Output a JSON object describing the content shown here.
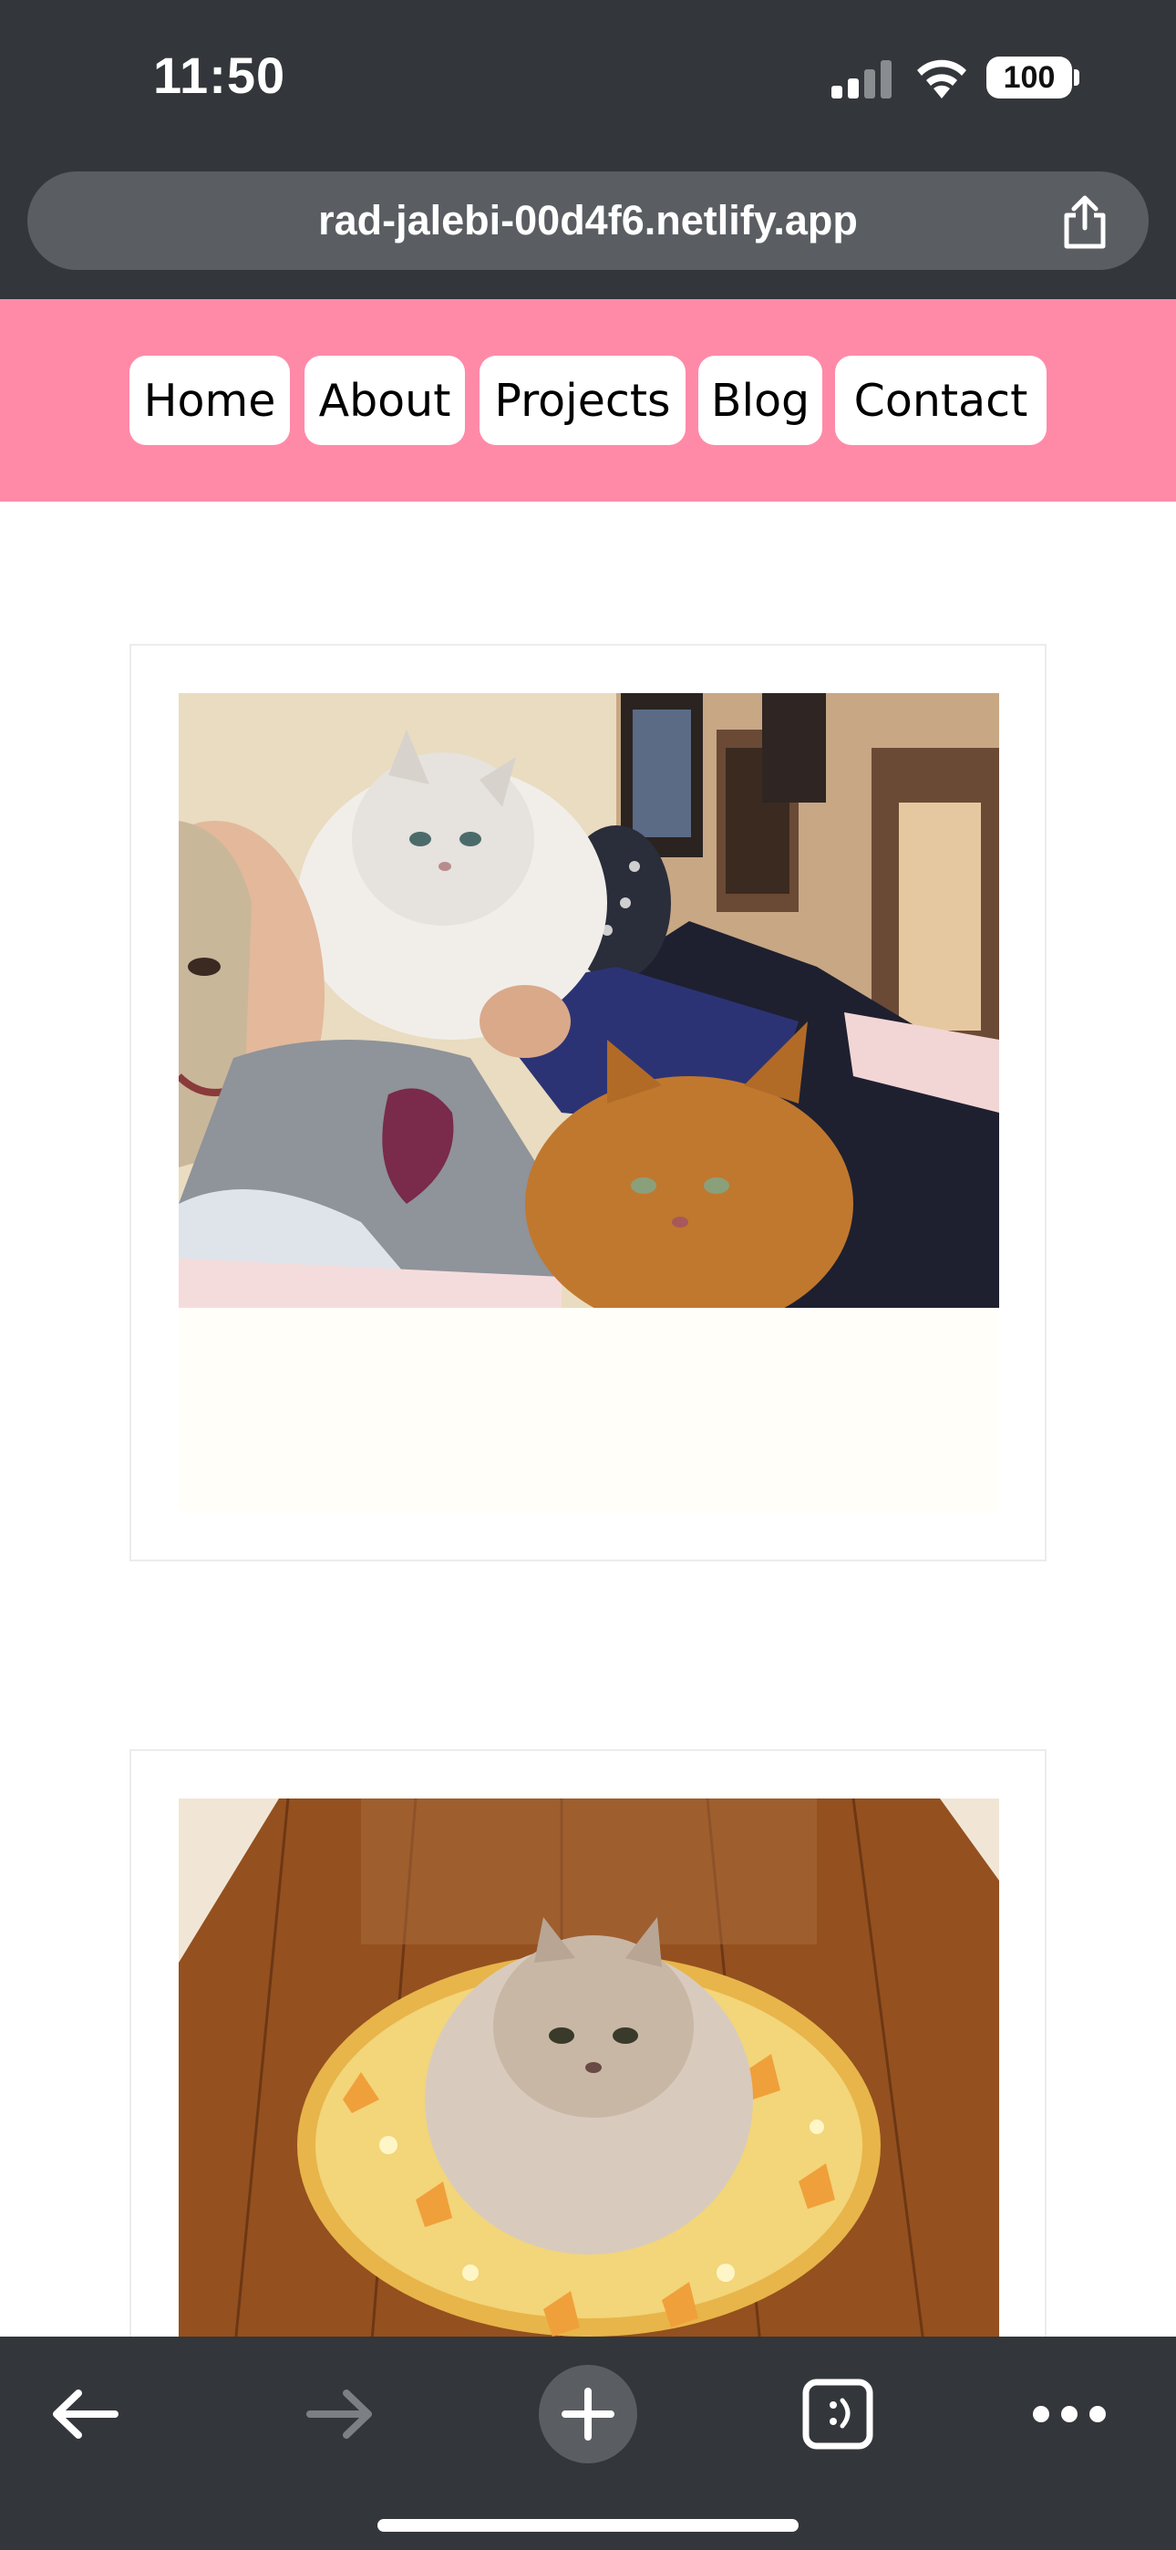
{
  "status_bar": {
    "time": "11:50",
    "battery": "100"
  },
  "address_bar": {
    "url": "rad-jalebi-00d4f6.netlify.app"
  },
  "nav": {
    "items": [
      {
        "label": "Home"
      },
      {
        "label": "About"
      },
      {
        "label": "Projects"
      },
      {
        "label": "Blog"
      },
      {
        "label": "Contact"
      }
    ]
  },
  "colors": {
    "browser_chrome": "#33363a",
    "address_field": "#5a5e62",
    "nav_background": "#ff8aa8",
    "nav_button": "#ffffff",
    "card_border": "#ececec",
    "caption_background": "#fffef9"
  },
  "icons": {
    "status": [
      "signal-icon",
      "wifi-icon",
      "battery-icon"
    ],
    "address": "share-icon",
    "toolbar": [
      "back-arrow-icon",
      "forward-arrow-icon",
      "plus-icon",
      "tabs-icon",
      "more-icon"
    ]
  }
}
